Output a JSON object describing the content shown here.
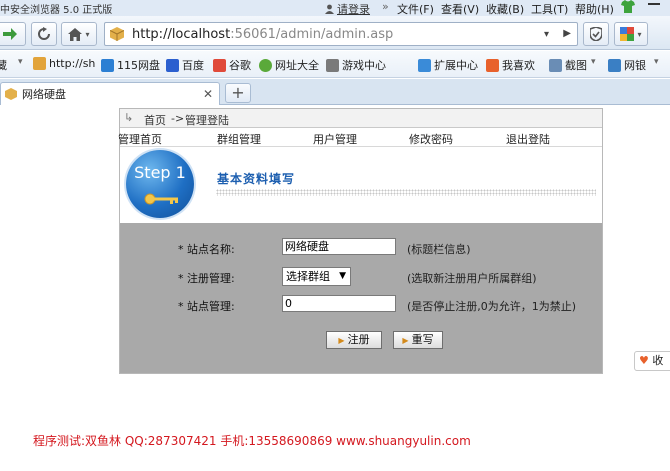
{
  "browser": {
    "title": "中安全浏览器 5.0 正式版",
    "login_label": "请登录",
    "menus": [
      "文件(F)",
      "查看(V)",
      "收藏(B)",
      "工具(T)",
      "帮助(H)"
    ],
    "url_host": "http://localhost",
    "url_rest": ":56061/admin/admin.asp"
  },
  "bookmarks": [
    {
      "label": "藏",
      "color": "#888888"
    },
    {
      "label": "http://sh",
      "color": "#e2a43b"
    },
    {
      "label": "115网盘",
      "color": "#2c7fd3"
    },
    {
      "label": "百度",
      "color": "#2b5fcf"
    },
    {
      "label": "谷歌",
      "color": "#e04a3a"
    },
    {
      "label": "网址大全",
      "color": "#5aa93a"
    },
    {
      "label": "游戏中心",
      "color": "#7a7a7a"
    },
    {
      "label": "扩展中心",
      "color": "#3a8bd8"
    },
    {
      "label": "我喜欢",
      "color": "#e8612c"
    },
    {
      "label": "截图",
      "color": "#6a8db5"
    },
    {
      "label": "网银",
      "color": "#3a7fc4"
    }
  ],
  "tab": {
    "title": "网络硬盘"
  },
  "breadcrumb": {
    "home": "首页",
    "sep": "->",
    "current": "管理登陆"
  },
  "nav_menu": [
    "管理首页",
    "群组管理",
    "用户管理",
    "修改密码",
    "退出登陆"
  ],
  "step": {
    "label": "Step 1",
    "heading": "基本资料填写"
  },
  "form": {
    "rows": [
      {
        "label": "* 站点名称:",
        "value": "网络硬盘",
        "hint": "(标题栏信息)"
      },
      {
        "label": "* 注册管理:",
        "value": "选择群组",
        "hint": "(选取新注册用户所属群组)"
      },
      {
        "label": "* 站点管理:",
        "value": "0",
        "hint": "(是否停止注册,0为允许，1为禁止)"
      }
    ],
    "register_button": "注册",
    "reset_button": "重写"
  },
  "side_fav": "收",
  "footer": "程序测试:双鱼林 QQ:287307421 手机:13558690869 www.shuangyulin.com"
}
